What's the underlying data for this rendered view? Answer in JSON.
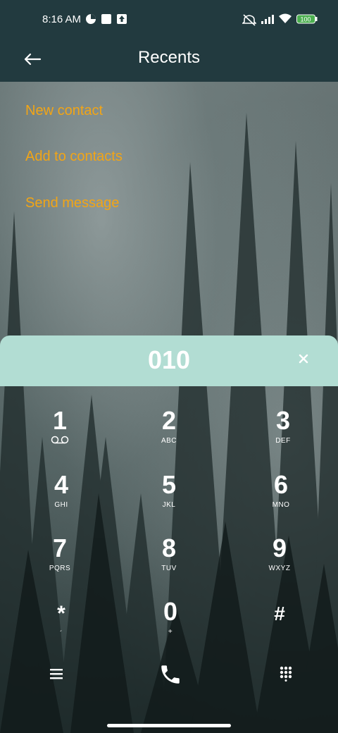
{
  "status_bar": {
    "time": "8:16 AM",
    "battery": "100",
    "icons": [
      "data-saver-icon",
      "square-icon",
      "upload-icon",
      "mute-icon",
      "signal-icon",
      "wifi-icon",
      "battery-icon"
    ]
  },
  "app_bar": {
    "title": "Recents",
    "back_icon": "arrow-left-icon"
  },
  "menu": {
    "items": [
      {
        "label": "New contact"
      },
      {
        "label": "Add to contacts"
      },
      {
        "label": "Send message"
      }
    ],
    "accent_color": "#f2a516"
  },
  "dialer": {
    "number": "010",
    "clear_icon": "close-icon",
    "display_color": "#b2ddd3",
    "keys": [
      {
        "digit": "1",
        "letters": "",
        "icon": "voicemail-icon"
      },
      {
        "digit": "2",
        "letters": "ABC"
      },
      {
        "digit": "3",
        "letters": "DEF"
      },
      {
        "digit": "4",
        "letters": "GHI"
      },
      {
        "digit": "5",
        "letters": "JKL"
      },
      {
        "digit": "6",
        "letters": "MNO"
      },
      {
        "digit": "7",
        "letters": "PQRS"
      },
      {
        "digit": "8",
        "letters": "TUV"
      },
      {
        "digit": "9",
        "letters": "WXYZ"
      },
      {
        "digit": "*",
        "letters": "´"
      },
      {
        "digit": "0",
        "letters": "+"
      },
      {
        "digit": "#",
        "letters": ""
      }
    ]
  },
  "bottom_bar": {
    "left_icon": "menu-icon",
    "center_icon": "phone-call-icon",
    "right_icon": "dialpad-icon"
  }
}
